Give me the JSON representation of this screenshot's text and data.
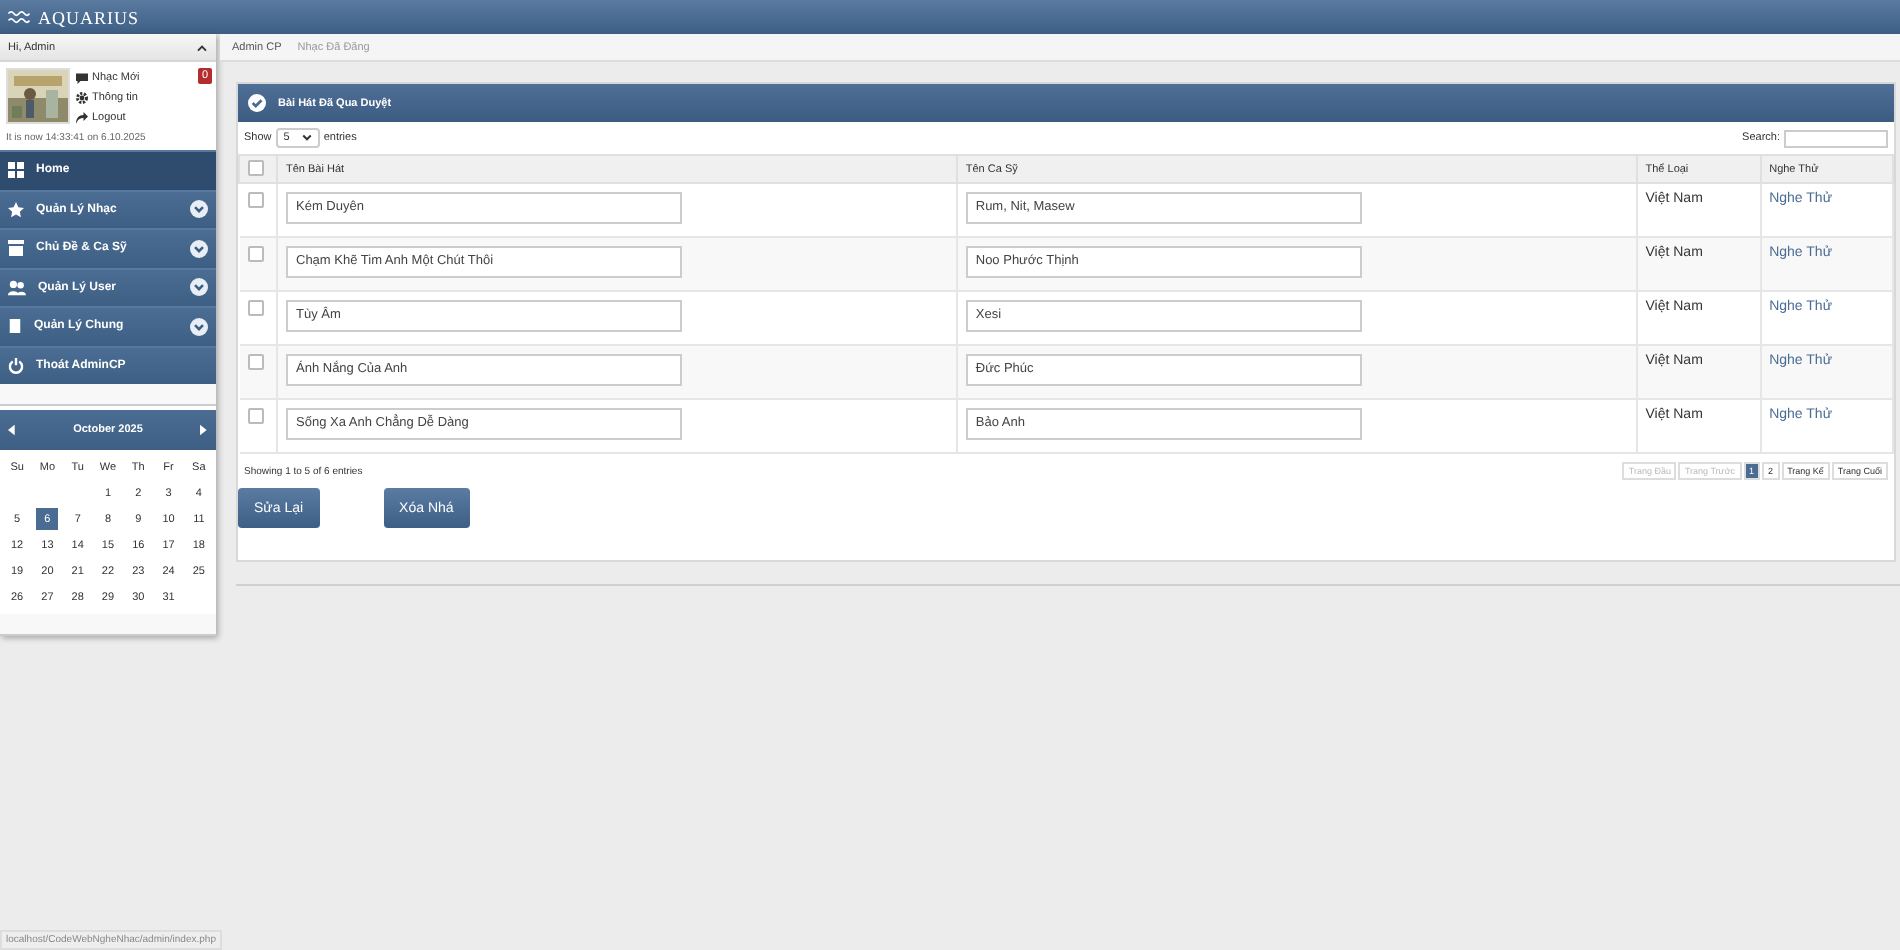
{
  "header": {
    "logo_text": "AQUARIUS"
  },
  "sidebar": {
    "greeting": "Hi, Admin",
    "profile_links": [
      {
        "label": "Nhạc Mới"
      },
      {
        "label": "Thông tin"
      },
      {
        "label": "Logout"
      }
    ],
    "badge": "0",
    "clock": "It is now 14:33:41 on 6.10.2025",
    "menu": [
      {
        "label": "Home",
        "selected": true,
        "has_submenu": false
      },
      {
        "label": "Quản Lý Nhạc",
        "selected": false,
        "has_submenu": true
      },
      {
        "label": "Chủ Đề & Ca Sỹ",
        "selected": false,
        "has_submenu": true
      },
      {
        "label": "Quản Lý User",
        "selected": false,
        "has_submenu": true
      },
      {
        "label": "Quản Lý Chung",
        "selected": false,
        "has_submenu": true
      },
      {
        "label": "Thoát AdminCP",
        "selected": false,
        "has_submenu": false
      }
    ]
  },
  "calendar": {
    "month": "October 2025",
    "weekdays": [
      "Su",
      "Mo",
      "Tu",
      "We",
      "Th",
      "Fr",
      "Sa"
    ],
    "weeks": [
      [
        {
          "day": "1",
          "selected": false
        },
        {
          "day": "2",
          "selected": false
        },
        {
          "day": "3",
          "selected": false
        },
        {
          "day": "4",
          "selected": false
        }
      ],
      [
        {
          "day": "5",
          "selected": false
        },
        {
          "day": "6",
          "selected": true
        },
        {
          "day": "7",
          "selected": false
        },
        {
          "day": "8",
          "selected": false
        },
        {
          "day": "9",
          "selected": false
        },
        {
          "day": "10",
          "selected": false
        },
        {
          "day": "11",
          "selected": false
        }
      ],
      [
        {
          "day": "12",
          "selected": false
        },
        {
          "day": "13",
          "selected": false
        },
        {
          "day": "14",
          "selected": false
        },
        {
          "day": "15",
          "selected": false
        },
        {
          "day": "16",
          "selected": false
        },
        {
          "day": "17",
          "selected": false
        },
        {
          "day": "18",
          "selected": false
        }
      ],
      [
        {
          "day": "19",
          "selected": false
        },
        {
          "day": "20",
          "selected": false
        },
        {
          "day": "21",
          "selected": false
        },
        {
          "day": "22",
          "selected": false
        },
        {
          "day": "23",
          "selected": false
        },
        {
          "day": "24",
          "selected": false
        },
        {
          "day": "25",
          "selected": false
        }
      ],
      [
        {
          "day": "26",
          "selected": false
        },
        {
          "day": "27",
          "selected": false
        },
        {
          "day": "28",
          "selected": false
        },
        {
          "day": "29",
          "selected": false
        },
        {
          "day": "30",
          "selected": false
        },
        {
          "day": "31",
          "selected": false
        }
      ]
    ]
  },
  "breadcrumb": [
    "Admin CP",
    "Nhạc Đã Đăng"
  ],
  "panel": {
    "title": "Bài Hát Đã Qua Duyệt",
    "show_label": "Show",
    "page_size": "5",
    "entries_label": "entries",
    "search_label": "Search:",
    "select_all_checked": false,
    "columns": [
      "Tên Bài Hát",
      "Tên Ca Sỹ",
      "Thể Loại",
      "Nghe Thử"
    ],
    "rows": [
      {
        "checked": false,
        "song": "Kém Duyên",
        "singer": "Rum, Nit, Masew",
        "genre": "Việt Nam",
        "listen": "Nghe Thử"
      },
      {
        "checked": false,
        "song": "Chạm Khẽ Tim Anh Một Chút Thôi",
        "singer": "Noo Phước Thịnh",
        "genre": "Việt Nam",
        "listen": "Nghe Thử"
      },
      {
        "checked": false,
        "song": "Tùy Âm",
        "singer": "Xesi",
        "genre": "Việt Nam",
        "listen": "Nghe Thử"
      },
      {
        "checked": false,
        "song": "Ánh Nắng Của Anh",
        "singer": "Đức Phúc",
        "genre": "Việt Nam",
        "listen": "Nghe Thử"
      },
      {
        "checked": false,
        "song": "Sống Xa Anh Chẳng Dễ Dàng",
        "singer": "Bảo Anh",
        "genre": "Việt Nam",
        "listen": "Nghe Thử"
      }
    ],
    "info": "Showing 1 to 5 of 6 entries",
    "pages": [
      {
        "label": "Trang Đầu",
        "disabled": true,
        "selected": false
      },
      {
        "label": "Trang Trước",
        "disabled": true,
        "selected": false
      },
      {
        "label": "1",
        "disabled": false,
        "selected": true
      },
      {
        "label": "2",
        "disabled": false,
        "selected": false
      },
      {
        "label": "Trang Kế",
        "disabled": false,
        "selected": false
      },
      {
        "label": "Trang Cuối",
        "disabled": false,
        "selected": false
      }
    ],
    "buttons": [
      "Sửa Lại",
      "Xóa Nhá"
    ]
  },
  "status_bar": "localhost/CodeWebNgheNhac/admin/index.php"
}
